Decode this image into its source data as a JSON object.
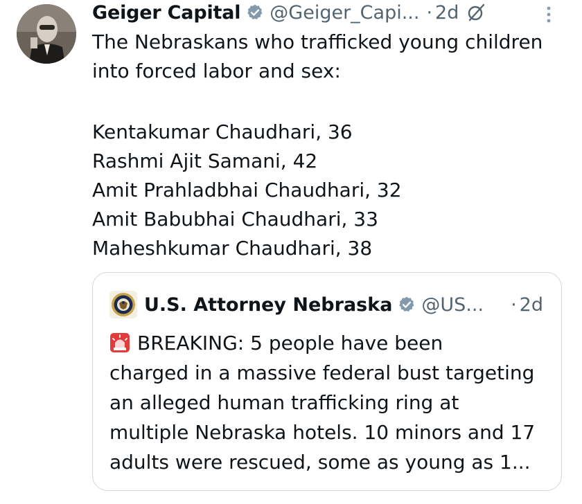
{
  "tweet": {
    "display_name": "Geiger Capital",
    "handle": "@Geiger_Capi...",
    "dot": "·",
    "time": "2d",
    "text_lines": [
      "The Nebraskans who trafficked young children",
      "into forced labor and sex:"
    ],
    "list_lines": [
      "Kentakumar Chaudhari, 36",
      "Rashmi Ajit Samani, 42",
      "Amit Prahladbhai Chaudhari, 32",
      "Amit Babubhai Chaudhari, 33",
      "Maheshkumar Chaudhari, 38"
    ]
  },
  "quote": {
    "display_name": "U.S. Attorney Nebraska",
    "handle": "@US...",
    "dot": "·",
    "time": "2d",
    "first_line": "BREAKING: 5 people have been",
    "text_lines": [
      "charged in a massive federal bust targeting",
      "an alleged human trafficking ring at",
      "multiple Nebraska hotels. 10 minors and 17",
      "adults were rescued, some as young as 1..."
    ]
  },
  "icons": {
    "verified": "verified-badge-icon",
    "edit": "edit-icon",
    "more": "more-vertical-icon",
    "siren": "siren-icon",
    "seal": "doj-seal-icon"
  },
  "colors": {
    "text": "#0f1419",
    "secondary": "#536471",
    "verified_gray": "#829aab",
    "border": "#cfd9de"
  }
}
